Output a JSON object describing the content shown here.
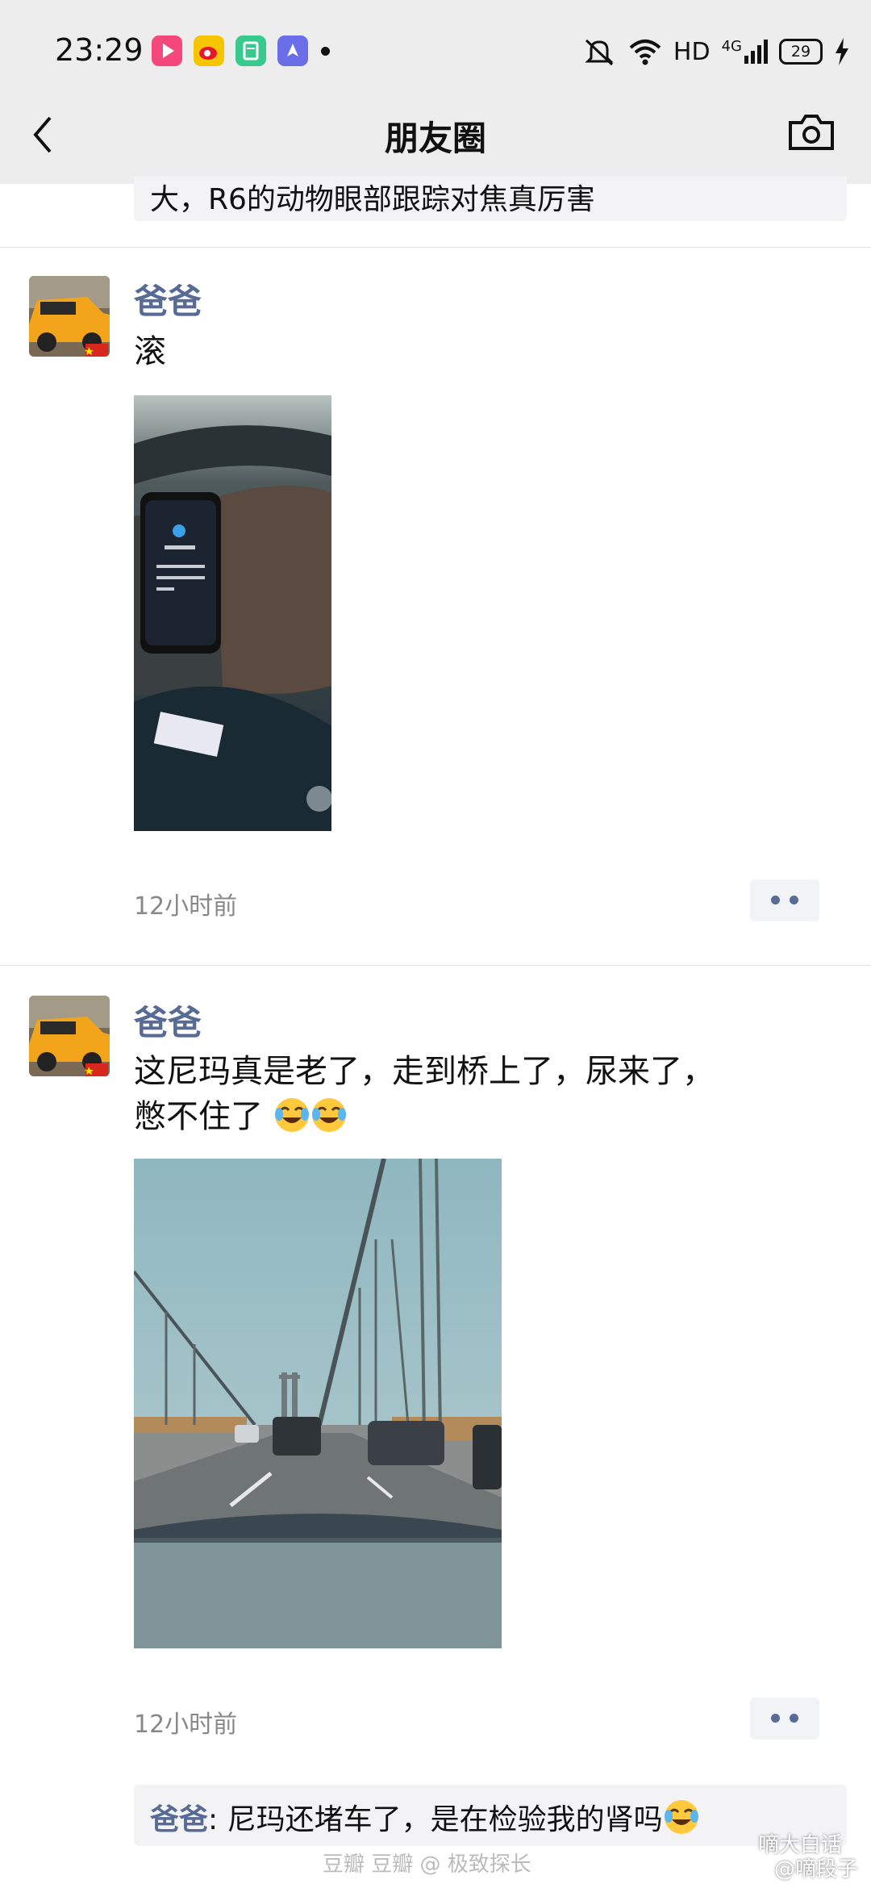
{
  "status_bar": {
    "time": "23:29",
    "network": "HD",
    "network_gen": "4G",
    "battery": "29"
  },
  "nav": {
    "title": "朋友圈"
  },
  "top_comment": {
    "text": "大，R6的动物眼部跟踪对焦真厉害"
  },
  "posts": [
    {
      "name": "爸爸",
      "text": "滚",
      "time": "12小时前",
      "image": "wrist-band-photo"
    },
    {
      "name": "爸爸",
      "text_line1": "这尼玛真是老了，走到桥上了，尿来了，",
      "text_line2": "憋不住了",
      "time": "12小时前",
      "image": "bridge-photo",
      "comment": {
        "name": "爸爸",
        "text": ": 尼玛还堵车了，是在检验我的肾吗"
      }
    }
  ],
  "watermarks": {
    "left": "豆瓣  豆瓣 @ 极致探长",
    "right_top": "嘀大白话",
    "right_bottom": "@嘀段子"
  },
  "colors": {
    "name_blue": "#576b95",
    "header_bg": "#ededed"
  }
}
